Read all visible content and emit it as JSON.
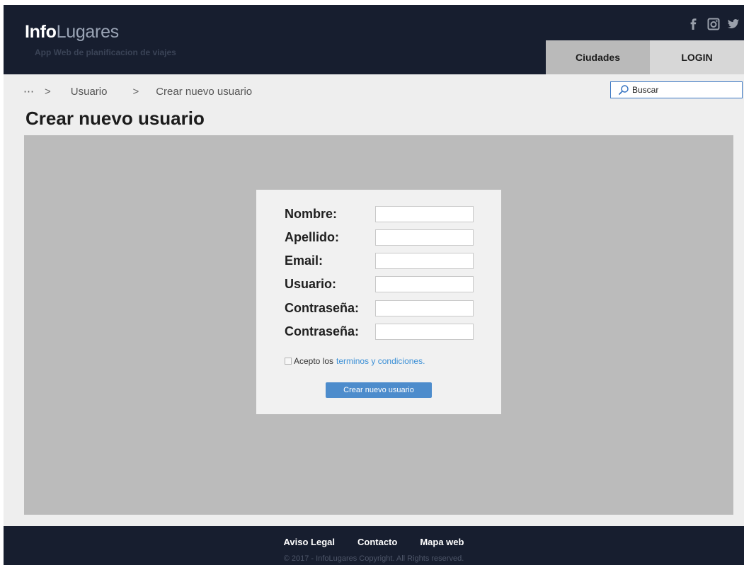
{
  "header": {
    "logo_bold": "Info",
    "logo_light": "Lugares",
    "tagline": "App Web de planificacion de viajes",
    "social_icons": [
      "facebook-icon",
      "instagram-icon",
      "twitter-icon"
    ],
    "nav": {
      "cities_label": "Ciudades",
      "login_label": "LOGIN"
    }
  },
  "breadcrumb": {
    "ellipsis": "⋯",
    "separator": ">",
    "items": [
      "Usuario",
      "Crear nuevo usuario"
    ]
  },
  "search": {
    "placeholder": "Buscar",
    "icon": "search-icon"
  },
  "page_title": "Crear nuevo usuario",
  "form": {
    "fields": [
      {
        "label": "Nombre:",
        "value": ""
      },
      {
        "label": "Apellido:",
        "value": ""
      },
      {
        "label": "Email:",
        "value": ""
      },
      {
        "label": "Usuario:",
        "value": ""
      },
      {
        "label": "Contraseña:",
        "value": ""
      },
      {
        "label": "Contraseña:",
        "value": ""
      }
    ],
    "terms_prefix": "Acepto los",
    "terms_link": "terminos y condiciones.",
    "terms_checked": false,
    "submit_label": "Crear nuevo usuario"
  },
  "footer": {
    "links": [
      "Aviso Legal",
      "Contacto",
      "Mapa web"
    ],
    "copyright": "© 2017 - InfoLugares Copyright. All Rights reserved."
  },
  "colors": {
    "header_bg": "#171e2f",
    "link": "#3a8fd6",
    "button": "#4d8ccc",
    "stage_bg": "#bbbbbb"
  }
}
